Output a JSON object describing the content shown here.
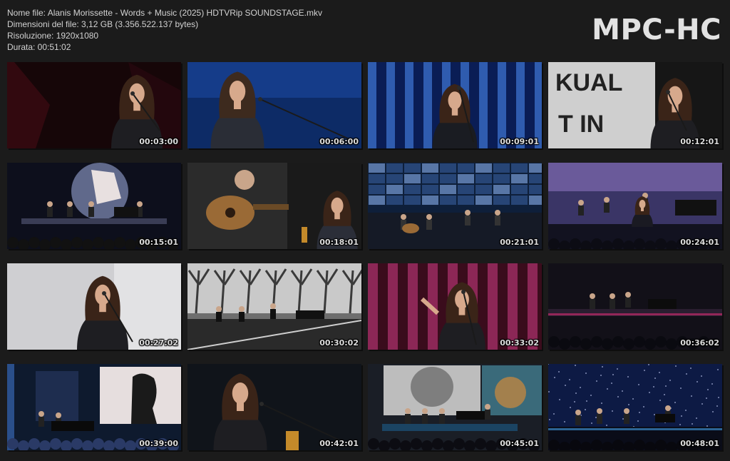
{
  "file_info": {
    "name_line": "Nome file: Alanis Morissette - Words + Music (2025) HDTVRip SOUNDSTAGE.mkv",
    "size_line": "Dimensioni del file: 3,12 GB (3.356.522.137 bytes)",
    "resolution_line": "Risoluzione: 1920x1080",
    "duration_line": "Durata: 00:51:02"
  },
  "brand": {
    "text": "MPC-HC"
  },
  "thumbnails": [
    {
      "timestamp": "00:03:00",
      "scene": "closeup-red"
    },
    {
      "timestamp": "00:06:00",
      "scene": "closeup-blue"
    },
    {
      "timestamp": "00:09:01",
      "scene": "stripes-blue"
    },
    {
      "timestamp": "00:12:01",
      "scene": "text-wall"
    },
    {
      "timestamp": "00:15:01",
      "scene": "stage-band-light"
    },
    {
      "timestamp": "00:18:01",
      "scene": "guitarist-closeup"
    },
    {
      "timestamp": "00:21:01",
      "scene": "stage-collage"
    },
    {
      "timestamp": "00:24:01",
      "scene": "stage-purple"
    },
    {
      "timestamp": "00:27:02",
      "scene": "closeup-white"
    },
    {
      "timestamp": "00:30:02",
      "scene": "stage-trees"
    },
    {
      "timestamp": "00:33:02",
      "scene": "stripes-pink"
    },
    {
      "timestamp": "00:36:02",
      "scene": "stage-dark"
    },
    {
      "timestamp": "00:39:00",
      "scene": "stage-silhouette"
    },
    {
      "timestamp": "00:42:01",
      "scene": "closeup-dark"
    },
    {
      "timestamp": "00:45:01",
      "scene": "stage-statue"
    },
    {
      "timestamp": "00:48:01",
      "scene": "stage-stars"
    }
  ]
}
